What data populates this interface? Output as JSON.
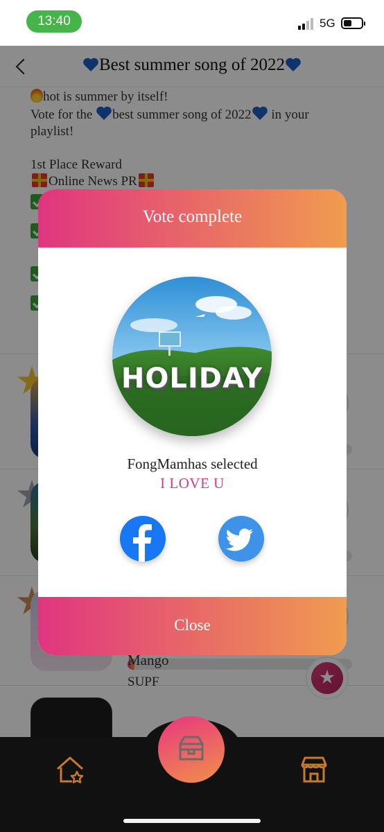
{
  "status_bar": {
    "time": "13:40",
    "network": "5G"
  },
  "header": {
    "title": "Best summer song of 2022"
  },
  "description": {
    "line1": "hot is summer by itself!",
    "line2": "Vote for the",
    "line2b": "best summer song of 2022",
    "line2c": "in your",
    "line3": "playlist!",
    "reward_title": "1st Place Reward",
    "reward_value": "Online News PR"
  },
  "list": {
    "item4_title": "Mango",
    "item4_artist": "SUPF"
  },
  "modal": {
    "title": "Vote complete",
    "album_text": "HOLIDAY",
    "selected_text": "FongMamhas selected",
    "song": "I LOVE U",
    "close_label": "Close"
  },
  "colors": {
    "accent_pink": "#e0357f",
    "accent_orange": "#f09c50",
    "song_text": "#cc3d8a",
    "facebook": "#1877f2",
    "twitter": "#3e93e8",
    "time_pill": "#45b449"
  },
  "icons": [
    "back-icon",
    "heart-icon",
    "gift-icon",
    "checkbox-icon",
    "facebook-icon",
    "twitter-icon",
    "home-star-icon",
    "box-icon",
    "shop-icon",
    "star-icon"
  ]
}
